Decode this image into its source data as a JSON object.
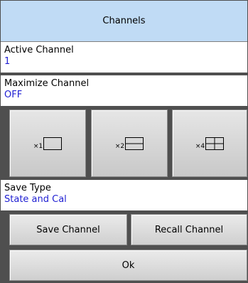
{
  "header": {
    "title": "Channels"
  },
  "active_channel": {
    "label": "Active Channel",
    "value": "1"
  },
  "maximize_channel": {
    "label": "Maximize Channel",
    "value": "OFF"
  },
  "layouts": [
    {
      "multiplier": "×1",
      "icon": "single-window-icon"
    },
    {
      "multiplier": "×2",
      "icon": "two-windows-icon"
    },
    {
      "multiplier": "×4",
      "icon": "four-windows-icon"
    }
  ],
  "save_type": {
    "label": "Save Type",
    "value": "State and Cal"
  },
  "buttons": {
    "save": "Save Channel",
    "recall": "Recall Channel",
    "ok": "Ok"
  },
  "colors": {
    "header_bg": "#c0dbf5",
    "value_text": "#1e1ed2",
    "background": "#4f4f4f"
  }
}
